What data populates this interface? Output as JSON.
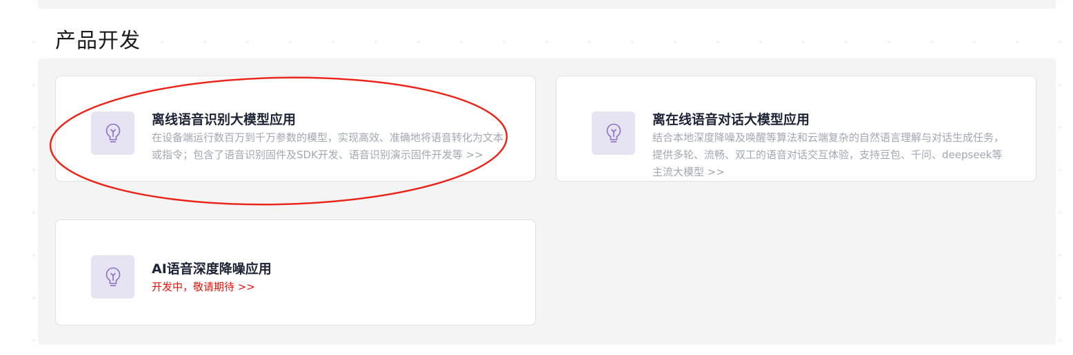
{
  "section": {
    "title": "产品开发"
  },
  "cards": [
    {
      "icon": "lightbulb-icon",
      "title": "离线语音识别大模型应用",
      "description": "在设备端运行数百万到千万参数的模型，实现高效、准确地将语音转化为文本或指令；包含了语音识别固件及SDK开发、语音识别演示固件开发等 >>"
    },
    {
      "icon": "lightbulb-icon",
      "title": "离在线语音对话大模型应用",
      "description": "结合本地深度降噪及唤醒等算法和云端复杂的自然语言理解与对话生成任务，提供多轮、流畅、双工的语音对话交互体验，支持豆包、千问、deepseek等主流大模型 >>"
    },
    {
      "icon": "lightbulb-icon",
      "title": "AI语音深度降噪应用",
      "status": "开发中，敬请期待 >>"
    }
  ],
  "colors": {
    "accent_icon": "#8b6fc0",
    "icon_bg": "#e6e3f3",
    "status_text": "#e1120c",
    "annotation": "#e8261c",
    "panel_bg": "#f4f4f4"
  }
}
